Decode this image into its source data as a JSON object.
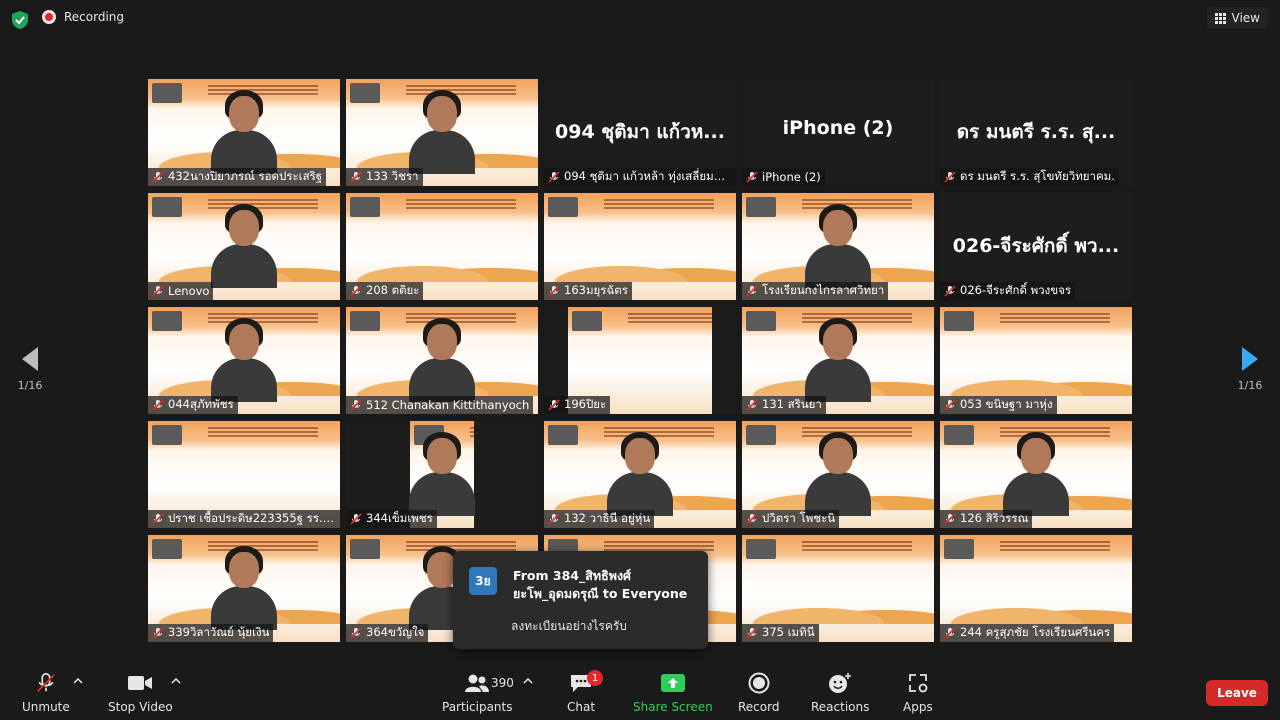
{
  "topbar": {
    "recording_label": "Recording",
    "view_label": "View"
  },
  "pagination": {
    "left": "1/16",
    "right": "1/16"
  },
  "tiles": [
    {
      "name": "432นางปิยาภรณ์ รอดประเสริฐ",
      "kind": "video"
    },
    {
      "name": "133 วิชรา",
      "kind": "video"
    },
    {
      "name": "094 ชุติมา แก้วหล้า ทุ่งเสลี่ยมชนู...",
      "big": "094 ชุติมา แก้วห...",
      "kind": "name"
    },
    {
      "name": "iPhone (2)",
      "big": "iPhone (2)",
      "kind": "name"
    },
    {
      "name": "ดร มนตรี ร.ร. สุโขทัยวิทยาคม.",
      "big": "ดร มนตรี ร.ร. สุ...",
      "kind": "name"
    },
    {
      "name": "Lenovo",
      "kind": "video"
    },
    {
      "name": "208 ตติยะ",
      "kind": "slide"
    },
    {
      "name": "163มยุรฉัตร",
      "kind": "slide"
    },
    {
      "name": "โรงเรียนกงไกรลาศวิทยา",
      "kind": "video"
    },
    {
      "name": "026-จีระศักดิ์ พวงขจร",
      "big": "026-จีระศักดิ์ พว...",
      "kind": "name"
    },
    {
      "name": "044สุภัทพัชร",
      "kind": "video"
    },
    {
      "name": "512 Chanakan Kittithanyoch",
      "kind": "video"
    },
    {
      "name": "196ปิยะ",
      "kind": "video"
    },
    {
      "name": "131 สรินยา",
      "kind": "video"
    },
    {
      "name": "053 ขนิษฐา มาหุ่ง",
      "kind": "slide"
    },
    {
      "name": "ปราช เชื้อประดิษ223355ฐ รร.สุโข...",
      "kind": "video"
    },
    {
      "name": "344เข็มเพชร",
      "kind": "video"
    },
    {
      "name": "132 วาธินี อยู่หุ่น",
      "kind": "video"
    },
    {
      "name": "ปวิตรา โพชะนิ",
      "kind": "video"
    },
    {
      "name": "126 สิริวรรณ",
      "kind": "video"
    },
    {
      "name": "339วิลาวัณย์ นุ้ยเงิน",
      "kind": "video"
    },
    {
      "name": "364ขวัญใจ",
      "kind": "video"
    },
    {
      "name": "",
      "kind": "slide"
    },
    {
      "name": "375 เมทินี",
      "kind": "slide"
    },
    {
      "name": "244 ครูสุภชัย โรงเรียนศรีนคร",
      "kind": "slide"
    }
  ],
  "chat_toast": {
    "avatar": "3ย",
    "title": "From 384_สิทธิพงศ์ ยะโพ_อุดมดรุณี to Everyone",
    "message": "ลงทะเบียนอย่างไรครับ"
  },
  "toolbar": {
    "unmute": "Unmute",
    "stop_video": "Stop Video",
    "participants": "Participants",
    "participants_count": "390",
    "chat": "Chat",
    "chat_badge": "1",
    "share_screen": "Share Screen",
    "record": "Record",
    "reactions": "Reactions",
    "apps": "Apps",
    "leave": "Leave"
  },
  "colors": {
    "background": "#1a1a1a",
    "active_speaker": "#a7d84c",
    "share_green": "#2fce5a",
    "leave_red": "#d52a2a"
  }
}
